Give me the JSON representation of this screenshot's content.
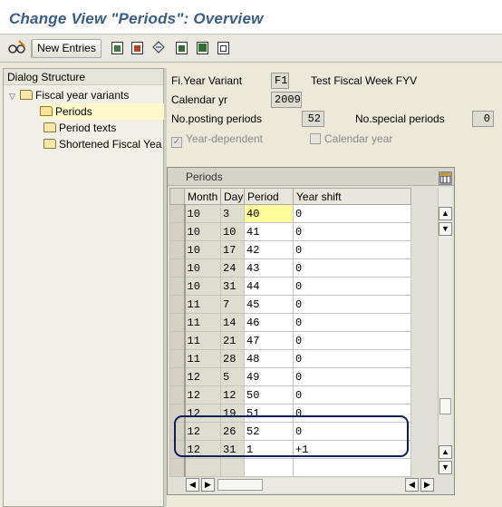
{
  "window": {
    "title": "Change View \"Periods\": Overview"
  },
  "toolbar": {
    "new_entries_label": "New Entries"
  },
  "dialog_structure": {
    "header": "Dialog Structure",
    "items": [
      {
        "label": "Fiscal year variants"
      },
      {
        "label": "Periods"
      },
      {
        "label": "Period texts"
      },
      {
        "label": "Shortened Fiscal Yea"
      }
    ]
  },
  "header_fields": {
    "fy_variant_label": "Fi.Year Variant",
    "fy_variant_value": "F1",
    "fy_variant_desc": "Test Fiscal Week FYV",
    "calendar_yr_label": "Calendar yr",
    "calendar_yr_value": "2009",
    "posting_periods_label": "No.posting periods",
    "posting_periods_value": "52",
    "special_periods_label": "No.special periods",
    "special_periods_value": "0",
    "year_dependent_label": "Year-dependent",
    "year_dependent_checked": true,
    "calendar_year_label": "Calendar year",
    "calendar_year_checked": false
  },
  "table": {
    "caption": "Periods",
    "columns": [
      "Month",
      "Day",
      "Period",
      "Year shift"
    ],
    "rows": [
      [
        "10",
        "3",
        "40",
        "0"
      ],
      [
        "10",
        "10",
        "41",
        "0"
      ],
      [
        "10",
        "17",
        "42",
        "0"
      ],
      [
        "10",
        "24",
        "43",
        "0"
      ],
      [
        "10",
        "31",
        "44",
        "0"
      ],
      [
        "11",
        "7",
        "45",
        "0"
      ],
      [
        "11",
        "14",
        "46",
        "0"
      ],
      [
        "11",
        "21",
        "47",
        "0"
      ],
      [
        "11",
        "28",
        "48",
        "0"
      ],
      [
        "12",
        "5",
        "49",
        "0"
      ],
      [
        "12",
        "12",
        "50",
        "0"
      ],
      [
        "12",
        "19",
        "51",
        "0"
      ],
      [
        "12",
        "26",
        "52",
        "0"
      ],
      [
        "12",
        "31",
        "1",
        "+1"
      ],
      [
        "",
        "",
        "",
        ""
      ]
    ]
  },
  "colors": {
    "title": "#3a5d86",
    "highlight_circle": "#0b1e5e",
    "active_cell": "#fffb9a"
  }
}
